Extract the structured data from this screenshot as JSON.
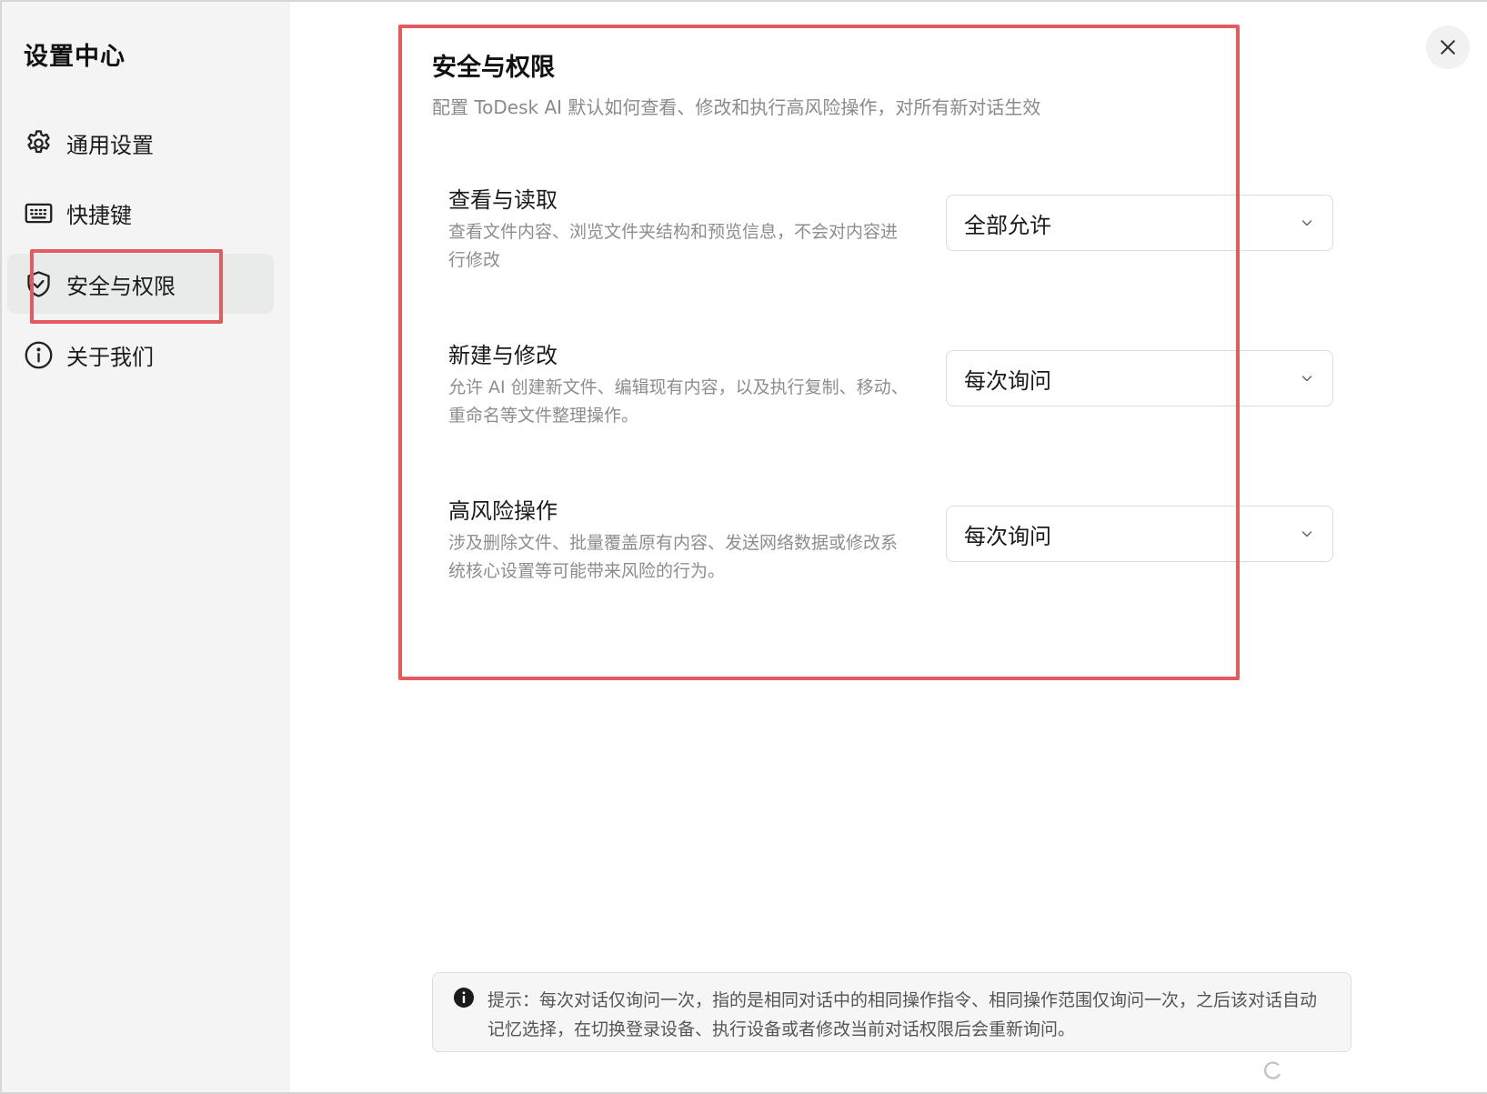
{
  "sidebar": {
    "title": "设置中心",
    "items": [
      {
        "label": "通用设置",
        "icon": "gear-icon",
        "active": false
      },
      {
        "label": "快捷键",
        "icon": "keyboard-icon",
        "active": false
      },
      {
        "label": "安全与权限",
        "icon": "shield-icon",
        "active": true
      },
      {
        "label": "关于我们",
        "icon": "info-icon",
        "active": false
      }
    ]
  },
  "main": {
    "title": "安全与权限",
    "subtitle": "配置 ToDesk AI 默认如何查看、修改和执行高风险操作，对所有新对话生效",
    "permissions": [
      {
        "title": "查看与读取",
        "description": "查看文件内容、浏览文件夹结构和预览信息，不会对内容进行修改",
        "selected": "全部允许"
      },
      {
        "title": "新建与修改",
        "description": "允许 AI 创建新文件、编辑现有内容，以及执行复制、移动、重命名等文件整理操作。",
        "selected": "每次询问"
      },
      {
        "title": "高风险操作",
        "description": "涉及删除文件、批量覆盖原有内容、发送网络数据或修改系统核心设置等可能带来风险的行为。",
        "selected": "每次询问"
      }
    ],
    "notice": "提示：每次对话仅询问一次，指的是相同对话中的相同操作指令、相同操作范围仅询问一次，之后该对话自动记忆选择，在切换登录设备、执行设备或者修改当前对话权限后会重新询问。"
  },
  "colors": {
    "highlight": "#e35b5f",
    "sidebar_bg": "#f4f4f4",
    "active_item_bg": "#e9eaea"
  }
}
